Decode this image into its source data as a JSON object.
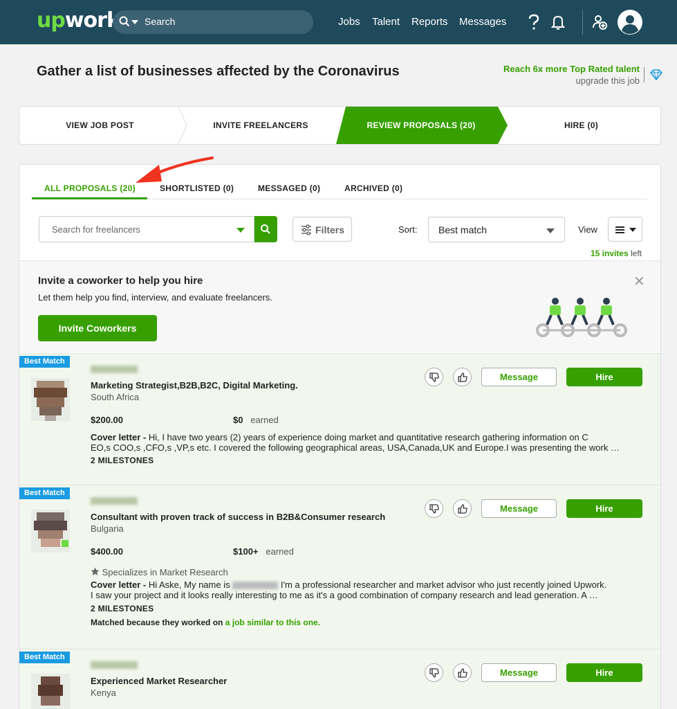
{
  "topnav": {
    "logo": {
      "up": "up",
      "work": "work"
    },
    "search_placeholder": "Search",
    "links": [
      "Jobs",
      "Talent",
      "Reports",
      "Messages"
    ]
  },
  "header": {
    "job_title": "Gather a list of businesses affected by the Coronavirus",
    "upgrade_line1": "Reach 6x more Top Rated talent",
    "upgrade_line2": "upgrade this job"
  },
  "steps": [
    "VIEW JOB POST",
    "INVITE FREELANCERS",
    "REVIEW PROPOSALS (20)",
    "HIRE (0)"
  ],
  "tabs": [
    "ALL PROPOSALS (20)",
    "SHORTLISTED (0)",
    "MESSAGED (0)",
    "ARCHIVED (0)"
  ],
  "toolbar": {
    "search_placeholder": "Search for freelancers",
    "filters_label": "Filters",
    "sort_label": "Sort:",
    "sort_value": "Best match",
    "view_label": "View",
    "invites_count": "15 invites",
    "invites_suffix": "left"
  },
  "banner": {
    "title": "Invite a coworker to help you hire",
    "desc": "Let them help you find, interview, and evaluate freelancers.",
    "button": "Invite Coworkers"
  },
  "proposals": [
    {
      "badge": "Best Match",
      "title": "Marketing Strategist,B2B,B2C, Digital Marketing.",
      "country": "South Africa",
      "rate": "$200.00",
      "earned_amount": "$0",
      "earned_label": "earned",
      "cover_label": "Cover letter -",
      "cover_line1": "Hi, I have two years (2) years of experience doing market and quantitative research gathering information on C",
      "cover_line2": "EO,s COO,s ,CFO,s ,VP,s etc. I covered the following geographical areas, USA,Canada,UK and Europe.I was presenting the work …",
      "milestones": "2 MILESTONES",
      "message": "Message",
      "hire": "Hire"
    },
    {
      "badge": "Best Match",
      "title": "Consultant with proven track of success in B2B&Consumer research",
      "country": "Bulgaria",
      "rate": "$400.00",
      "earned_amount": "$100+",
      "earned_label": "earned",
      "specializes": "Specializes in Market Research",
      "cover_label": "Cover letter -",
      "cover_pre": "Hi Aske, My name is",
      "cover_post": "I'm a professional researcher and market advisor who just recently joined Upwork.",
      "cover_line2": "I saw your project and it looks really interesting to me as it's a good combination of company research and lead generation. A …",
      "milestones": "2 MILESTONES",
      "match_pre": "Matched because they worked on",
      "match_link": "a job similar to this one.",
      "message": "Message",
      "hire": "Hire"
    },
    {
      "badge": "Best Match",
      "title": "Experienced Market Researcher",
      "country": "Kenya",
      "message": "Message",
      "hire": "Hire"
    }
  ],
  "colors": {
    "brand_green": "#37a000",
    "nav_bg": "#1f4a5c",
    "badge_blue": "#1a9be2",
    "row_bg": "#f1f7ec",
    "arrow": "#f0321e"
  }
}
